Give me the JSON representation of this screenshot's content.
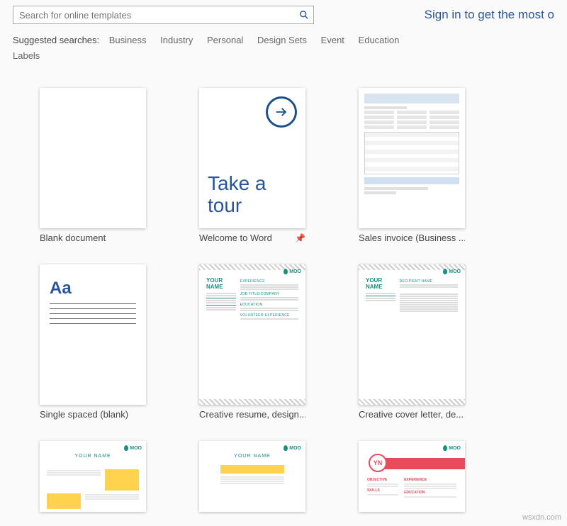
{
  "search": {
    "placeholder": "Search for online templates"
  },
  "signin": "Sign in to get the most o",
  "suggested": {
    "label": "Suggested searches:",
    "items": [
      "Business",
      "Industry",
      "Personal",
      "Design Sets",
      "Event",
      "Education",
      "Labels"
    ]
  },
  "templates": [
    {
      "caption": "Blank document",
      "pinned": false
    },
    {
      "caption": "Welcome to Word",
      "pinned": true,
      "tour_text": "Take a tour"
    },
    {
      "caption": "Sales invoice (Business ...",
      "pinned": false
    },
    {
      "caption": "Single spaced (blank)",
      "pinned": false,
      "glyph": "Aa"
    },
    {
      "caption": "Creative resume, design...",
      "pinned": false,
      "brand": "MOO",
      "name_label": "YOUR NAME"
    },
    {
      "caption": "Creative cover letter, de...",
      "pinned": false,
      "brand": "MOO",
      "name_label": "YOUR NAME"
    },
    {
      "caption": "",
      "pinned": false,
      "brand": "MOO",
      "name_label": "YOUR NAME"
    },
    {
      "caption": "",
      "pinned": false,
      "brand": "MOO",
      "name_label": "YOUR NAME"
    },
    {
      "caption": "",
      "pinned": false,
      "brand": "MOO",
      "yn": "YN"
    }
  ],
  "watermark": "wsxdn.com"
}
